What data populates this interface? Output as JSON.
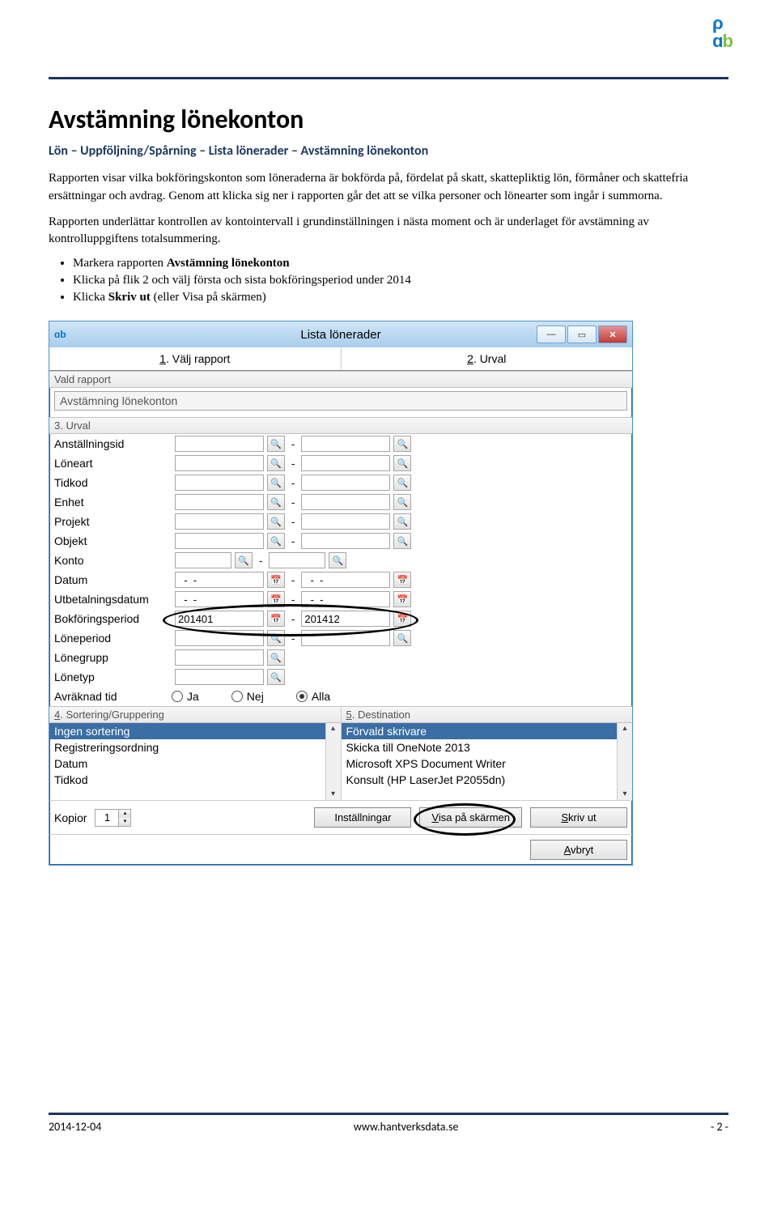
{
  "doc": {
    "heading": "Avstämning lönekonton",
    "subheading": "Lön – Uppföljning/Spårning – Lista lönerader – Avstämning lönekonton",
    "para1": "Rapporten visar vilka bokföringskonton som löneraderna är bokförda på, fördelat på skatt, skattepliktig lön, förmåner och skattefria ersättningar och avdrag. Genom att klicka sig ner i rapporten går det att se vilka personer och lönearter som ingår i summorna.",
    "para2": "Rapporten underlättar kontrollen av kontointervall i grundinställningen i nästa moment och är underlaget för avstämning av kontrolluppgiftens totalsummering.",
    "bullets": [
      "Markera rapporten Avstämning lönekonton",
      "Klicka på flik 2 och välj första och sista bokföringsperiod under 2014",
      "Klicka Skriv ut (eller Visa på skärmen)"
    ],
    "bullets_bold": [
      "Avstämning lönekonton",
      "Skriv ut"
    ]
  },
  "win": {
    "title": "Lista lönerader",
    "tabs": {
      "t1": "1. Välj rapport",
      "t2": "2. Urval"
    },
    "vald_rapport_hdr": "Vald rapport",
    "vald_rapport_val": "Avstämning lönekonton",
    "urval_hdr": "3. Urval",
    "rows": {
      "anstallningsid": "Anställningsid",
      "loneart": "Löneart",
      "tidkod": "Tidkod",
      "enhet": "Enhet",
      "projekt": "Projekt",
      "objekt": "Objekt",
      "konto": "Konto",
      "datum": "Datum",
      "utbetalningsdatum": "Utbetalningsdatum",
      "bokforingsperiod": "Bokföringsperiod",
      "loneperiod": "Löneperiod",
      "lonegrupp": "Lönegrupp",
      "lonetyp": "Lönetyp",
      "avraknad_tid": "Avräknad tid"
    },
    "bokfor_from": "201401",
    "bokfor_to": "201412",
    "radio": {
      "ja": "Ja",
      "nej": "Nej",
      "alla": "Alla"
    },
    "sort_hdr": "4. Sortering/Gruppering",
    "sort_items": [
      "Ingen sortering",
      "Registreringsordning",
      "Datum",
      "Tidkod"
    ],
    "dest_hdr": "5. Destination",
    "dest_items": [
      "Förvald skrivare",
      "Skicka till OneNote 2013",
      "Microsoft XPS Document Writer",
      "Konsult (HP LaserJet P2055dn)"
    ],
    "kopior_lbl": "Kopior",
    "kopior_val": "1",
    "btn_installningar": "Inställningar",
    "btn_visa": "Visa på skärmen",
    "btn_skriv": "Skriv ut",
    "btn_avbryt": "Avbryt"
  },
  "footer": {
    "date": "2014-12-04",
    "url": "www.hantverksdata.se",
    "page": "- 2 -"
  }
}
